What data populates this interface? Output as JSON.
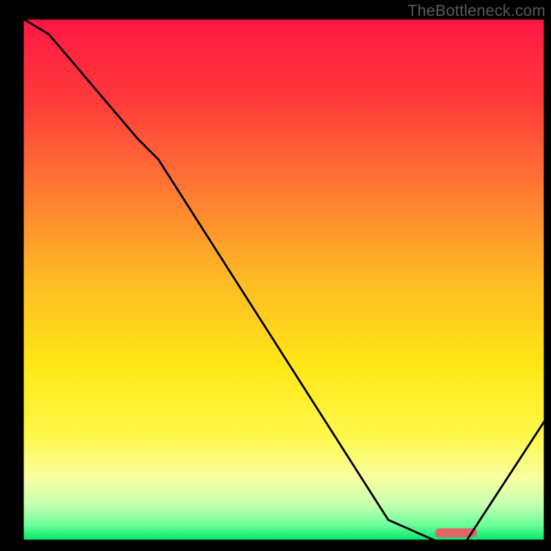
{
  "watermark": "TheBottleneck.com",
  "chart_data": {
    "type": "line",
    "title": "",
    "xlabel": "",
    "ylabel": "",
    "xlim": [
      0,
      100
    ],
    "ylim": [
      0,
      100
    ],
    "series": [
      {
        "name": "curve",
        "x": [
          0,
          5,
          22,
          26,
          70,
          79,
          85,
          100
        ],
        "values": [
          100,
          97,
          77,
          73,
          4,
          0,
          0,
          23
        ]
      }
    ],
    "gradient_stops": [
      {
        "offset": 0.0,
        "color": "#ff1744"
      },
      {
        "offset": 0.16,
        "color": "#ff3b3b"
      },
      {
        "offset": 0.33,
        "color": "#ff7a33"
      },
      {
        "offset": 0.5,
        "color": "#ffba24"
      },
      {
        "offset": 0.67,
        "color": "#ffe817"
      },
      {
        "offset": 0.8,
        "color": "#fff84a"
      },
      {
        "offset": 0.88,
        "color": "#f8ffa2"
      },
      {
        "offset": 0.93,
        "color": "#c8ffb0"
      },
      {
        "offset": 0.97,
        "color": "#6bff9a"
      },
      {
        "offset": 1.0,
        "color": "#00e56b"
      }
    ],
    "marker": {
      "x_start": 79,
      "x_end": 87,
      "y": 1.5,
      "color": "#e06666"
    },
    "frame_color": "#000000",
    "curve_color": "#000000",
    "curve_width": 3
  }
}
